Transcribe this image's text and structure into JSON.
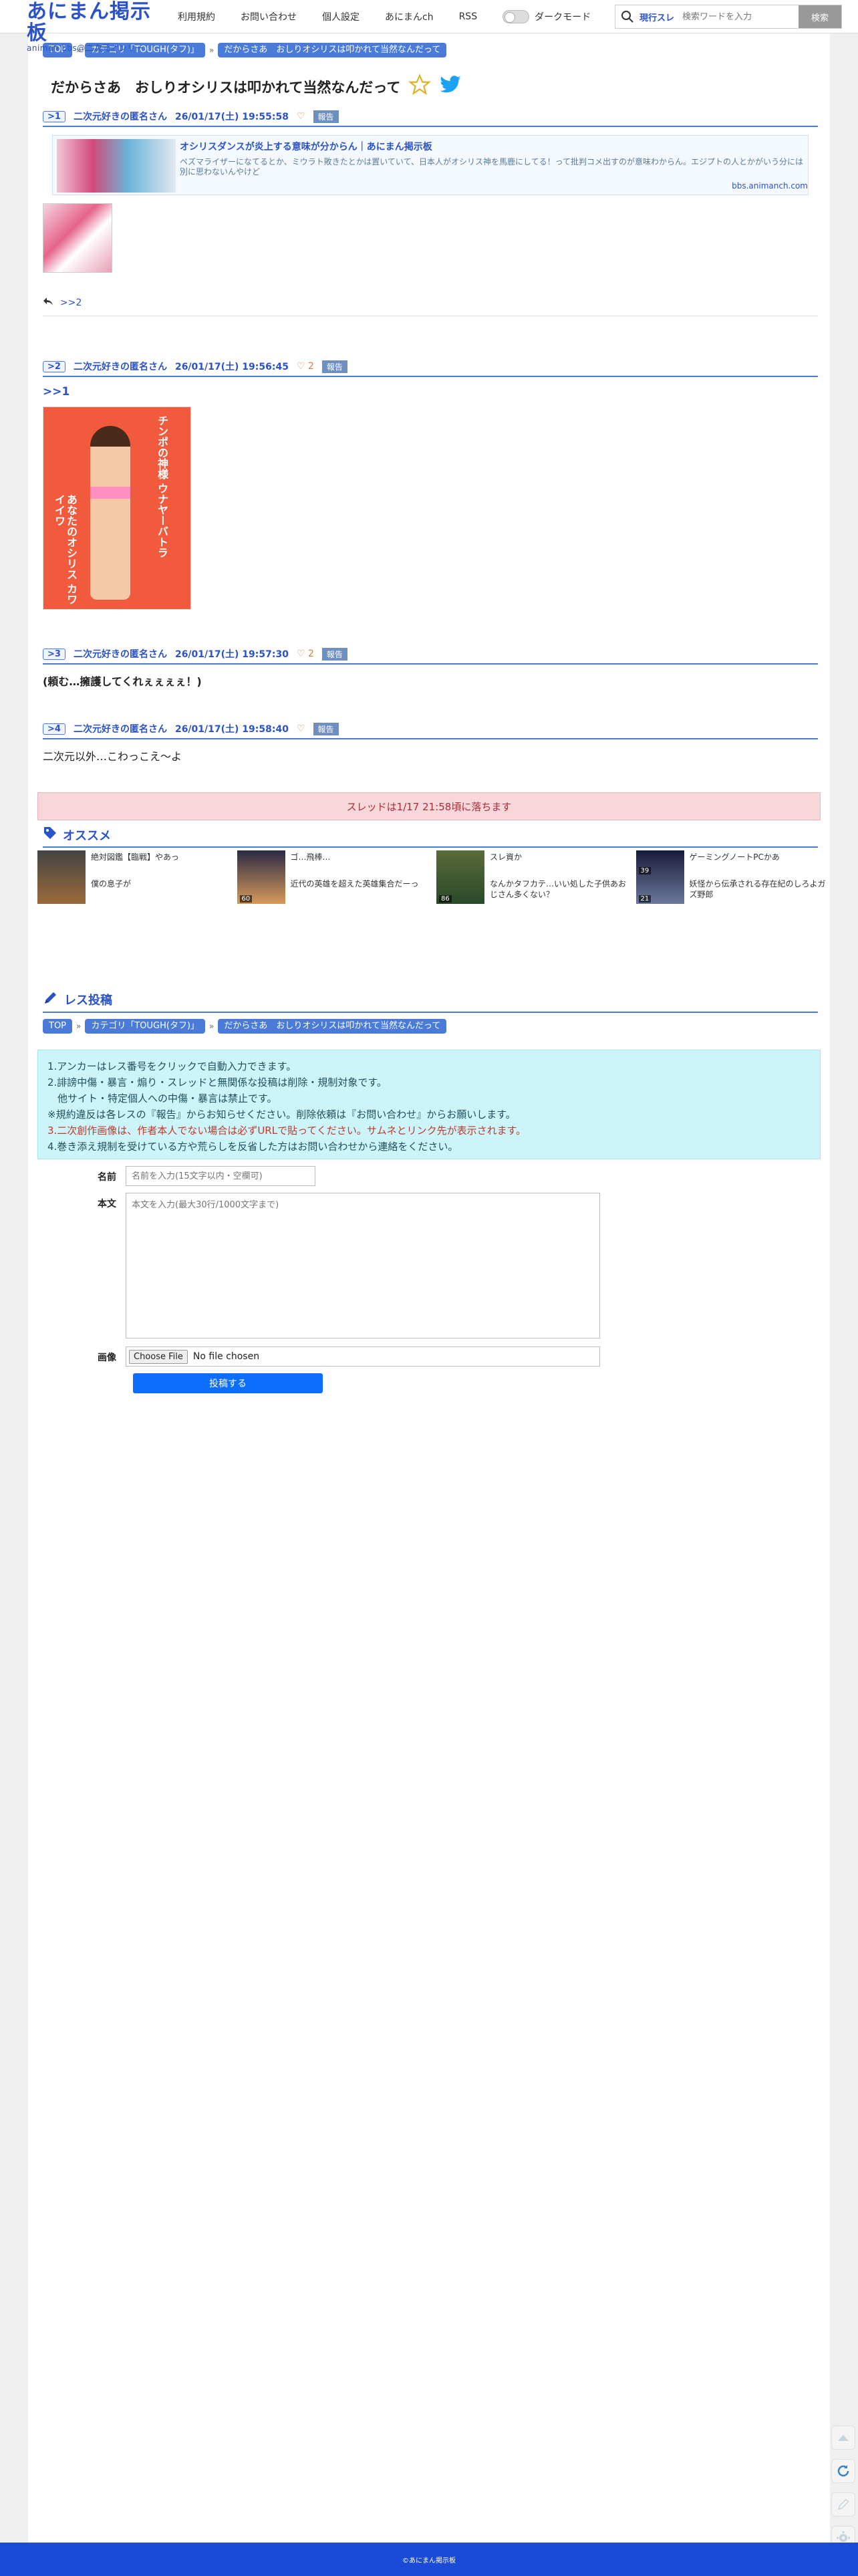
{
  "header": {
    "logo_main": "あにまん掲示板",
    "logo_sub": "animan bbs@二次元オンリー",
    "nav": [
      "利用規約",
      "お問い合わせ",
      "個人設定",
      "あにまんch",
      "RSS"
    ],
    "dark_mode": "ダークモード",
    "search_scope": "現行スレ",
    "search_placeholder": "検索ワードを入力",
    "search_button": "検索"
  },
  "breadcrumb": [
    "TOP",
    "カテゴリ「TOUGH(タフ)」",
    "だからさあ　おしりオシリスは叩かれて当然なんだって"
  ],
  "thread_title": "だからさあ　おしりオシリスは叩かれて当然なんだって",
  "posts": [
    {
      "num": ">1",
      "name": "二次元好きの匿名さん",
      "date": "26/01/17(土) 19:55:58",
      "likes": "",
      "report": "報告",
      "linkcard": {
        "title": "オシリスダンスが炎上する意味が分からん｜あにまん掲示板",
        "desc": "ペズマライザーになてるとか、ミウラト敗きたとかは置いていて、日本人がオシリス神を馬鹿にしてる！って批判コメ出すのが意味わからん。エジプトの人とかがいう分には別に思わないんやけど",
        "domain": "bbs.animanch.com"
      },
      "reply": ">>2"
    },
    {
      "num": ">2",
      "name": "二次元好きの匿名さん",
      "date": "26/01/17(土) 19:56:45",
      "likes": "2",
      "report": "報告",
      "anchor": ">>1",
      "poster_top": "チンポの神様 ウナヤーバトラ",
      "poster_bottom": "あなたのオシリス カワイイワ"
    },
    {
      "num": ">3",
      "name": "二次元好きの匿名さん",
      "date": "26/01/17(土) 19:57:30",
      "likes": "2",
      "report": "報告",
      "text": "(頼む…擁護してくれぇぇぇぇ！)"
    },
    {
      "num": ">4",
      "name": "二次元好きの匿名さん",
      "date": "26/01/17(土) 19:58:40",
      "likes": "",
      "report": "報告",
      "text": "二次元以外…こわっこえ〜よ"
    }
  ],
  "expire_notice": "スレッドは1/17 21:58頃に落ちます",
  "recommend": {
    "title": "オススメ",
    "items": [
      {
        "count": "",
        "text": "絶対図鑑【臨戦】やあっ"
      },
      {
        "count": "",
        "text": "ゴ…飛棒…"
      },
      {
        "count": "",
        "text": "スレ資か"
      },
      {
        "count": "39",
        "text": "ゲーミングノートPCかあ"
      },
      {
        "count": "21",
        "text": "僕の息子が"
      },
      {
        "count": "60",
        "text": "近代の英雄を超えた英雄集合だーっ"
      },
      {
        "count": "86",
        "text": "なんかタフカテ…いい処した子供あおじさん多くない？"
      },
      {
        "count": "21",
        "text": "妖怪から伝承される存在紀のしろよガズ野郎"
      }
    ]
  },
  "form": {
    "title": "レス投稿",
    "notes": [
      "1.アンカーはレス番号をクリックで自動入力できます。",
      "2.誹謗中傷・暴言・煽り・スレッドと無関係な投稿は削除・規制対象です。",
      "　他サイト・特定個人への中傷・暴言は禁止です。",
      "※規約違反は各レスの『報告』からお知らせください。削除依頼は『お問い合わせ』からお願いします。",
      "3.二次創作画像は、作者本人でない場合は必ずURLで貼ってください。サムネとリンク先が表示されます。",
      "4.巻き添え規制を受けている方や荒らしを反省した方はお問い合わせから連絡をください。"
    ],
    "name_label": "名前",
    "name_placeholder": "名前を入力(15文字以内・空欄可)",
    "body_label": "本文",
    "body_placeholder": "本文を入力(最大30行/1000文字まで)",
    "image_label": "画像",
    "file_button": "Choose File",
    "file_status": "No file chosen",
    "submit": "投稿する"
  },
  "footer": "©あにまん掲示板"
}
